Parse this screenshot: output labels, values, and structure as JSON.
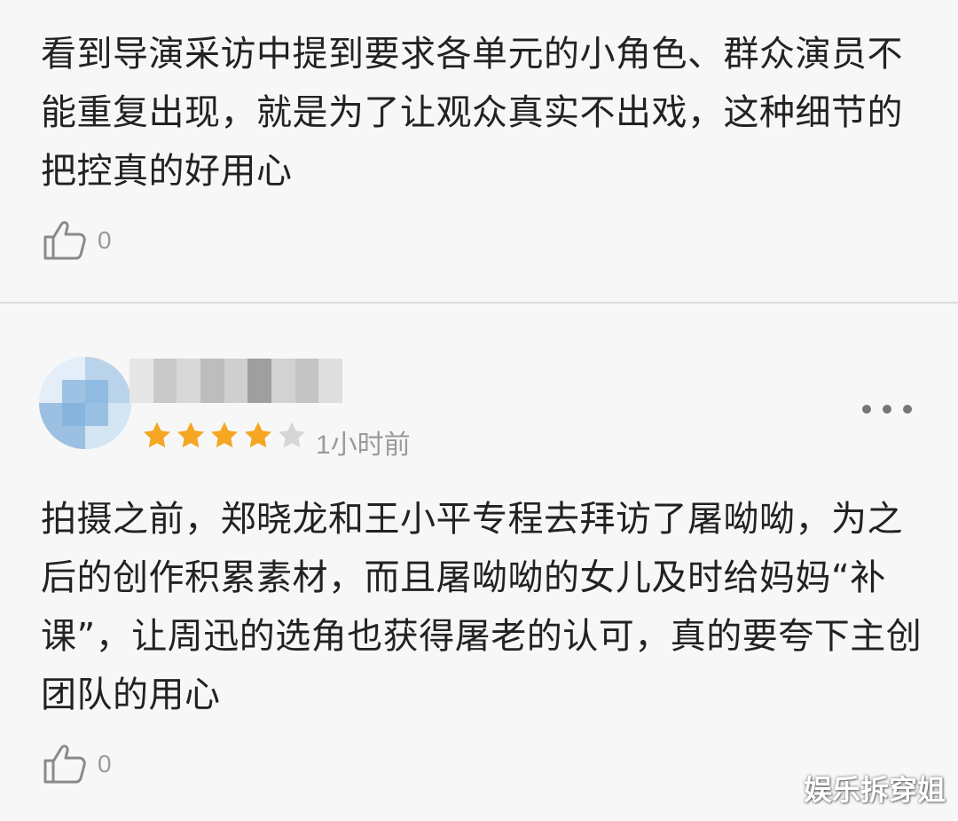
{
  "colors": {
    "background": "#f7f7f7",
    "text": "#222222",
    "muted": "#9a9a9a",
    "star_filled": "#f5a623",
    "star_empty": "#d6d6d6",
    "divider": "#dcdcdc"
  },
  "comments": [
    {
      "text": "看到导演采访中提到要求各单元的小角色、群众演员不能重复出现，就是为了让观众真实不出戏，这种细节的把控真的好用心",
      "like_icon": "thumbs-up-icon",
      "like_count": "0"
    },
    {
      "rating": 4,
      "rating_max": 5,
      "time_ago": "1小时前",
      "more_icon": "more-dots-icon",
      "text": "拍摄之前，郑晓龙和王小平专程去拜访了屠呦呦，为之后的创作积累素材，而且屠呦呦的女儿及时给妈妈“补课”，让周迅的选角也获得屠老的认可，真的要夸下主创团队的用心",
      "like_icon": "thumbs-up-icon",
      "like_count": "0"
    }
  ],
  "watermark": "娱乐拆穿姐"
}
